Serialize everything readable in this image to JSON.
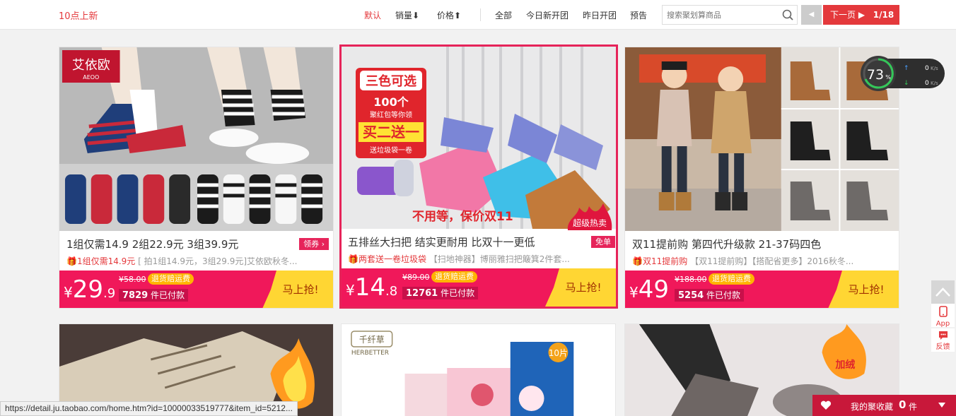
{
  "header": {
    "brand": "10点上新",
    "sort_default": "默认",
    "sort_sales": "销量⬇",
    "sort_price": "价格⬆",
    "filter_all": "全部",
    "filter_today": "今日新开团",
    "filter_yesterday": "昨日开团",
    "filter_preview": "预告",
    "search_placeholder": "搜索聚划算商品",
    "prev_label": "◀",
    "next_label": "下一页 ▶",
    "page_indicator": "1/18"
  },
  "products": [
    {
      "title": "1组仅需14.9  2组22.9元  3组39.9元",
      "tag": "领券 ›",
      "promo_highlight": "1组仅需14.9元",
      "promo_rest": "[ 拍1组14.9元，3组29.9元]艾依欧秋冬...",
      "price_int": "29",
      "price_dec": ".9",
      "orig_price": "¥58.00",
      "badge": "退货赔运费",
      "sold_count": "7829",
      "sold_suffix": "件已付款",
      "buy_label": "马上抢!",
      "image_logo": "艾依欧",
      "image_logo_sub": "AEOO"
    },
    {
      "title": "五排丝大扫把  结实更耐用  比双十一更低",
      "tag": "免单",
      "promo_highlight": "两套送一卷垃圾袋",
      "promo_rest": "【扫地神器】博丽雅扫把簸箕2件套...",
      "price_int": "14",
      "price_dec": ".8",
      "orig_price": "¥89.00",
      "badge": "退货赔运费",
      "sold_count": "12761",
      "sold_suffix": "件已付款",
      "buy_label": "马上抢!",
      "image_text_1": "三色可选",
      "image_text_2": "100个",
      "image_text_3": "聚红包等你领",
      "image_text_4": "买二送一",
      "image_text_5": "送垃圾袋一卷",
      "image_text_6": "不用等，保价双11",
      "hot_label": "超级热卖"
    },
    {
      "title": "双11提前购  第四代升级款  21-37码四色",
      "tag": "",
      "promo_highlight": "双11提前购",
      "promo_rest": "【双11提前购】【搭配省更多】2016秋冬...",
      "price_int": "49",
      "price_dec": "",
      "orig_price": "¥188.00",
      "badge": "退货赔运费",
      "sold_count": "5254",
      "sold_suffix": "件已付款",
      "buy_label": "马上抢!"
    }
  ],
  "row2": {
    "brand_cn": "千纤草",
    "brand_en": "HERBETTER",
    "pack_count": "10片",
    "hot_text": "加绒"
  },
  "widgets": {
    "gauge_percent": "73",
    "gauge_unit": "%",
    "upload": "0",
    "download": "0",
    "speed_unit": "K/s",
    "app_label": "App",
    "feedback_label": "反馈",
    "fav_label": "我的聚收藏",
    "fav_count": "0",
    "fav_unit": "件"
  },
  "status_url": "https://detail.ju.taobao.com/home.htm?id=10000033519777&item_id=5212...",
  "colors": {
    "accent": "#e4393c",
    "pricebar": "#f0185a",
    "buy": "#ffd633",
    "badge": "#ffb400"
  }
}
